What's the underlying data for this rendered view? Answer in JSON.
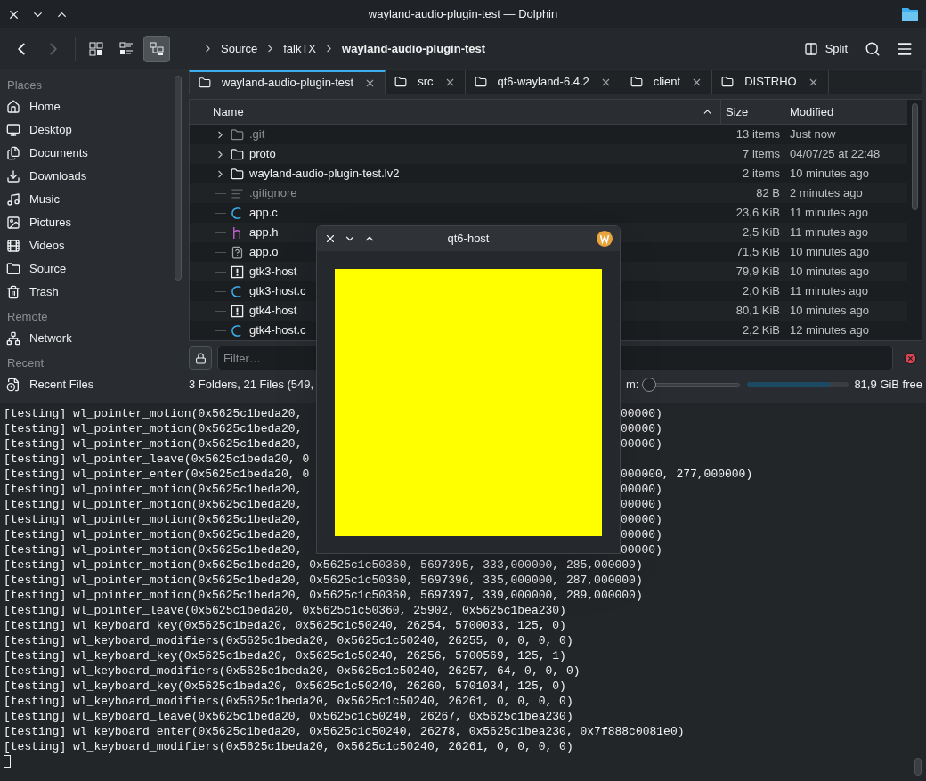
{
  "window": {
    "title": "wayland-audio-plugin-test — Dolphin"
  },
  "toolbar": {
    "back": {
      "disabled": false
    },
    "forward": {
      "disabled": true
    },
    "view_modes": [
      {
        "kind": "icons",
        "selected": false
      },
      {
        "kind": "compact",
        "selected": false
      },
      {
        "kind": "details",
        "selected": true
      }
    ],
    "breadcrumb": [
      {
        "label": "Source",
        "current": false
      },
      {
        "label": "falkTX",
        "current": false
      },
      {
        "label": "wayland-audio-plugin-test",
        "current": true
      }
    ],
    "split": "Split"
  },
  "sidebar": {
    "sections": [
      {
        "title": "Places",
        "items": [
          {
            "label": "Home",
            "kind": "home"
          },
          {
            "label": "Desktop",
            "kind": "desktop"
          },
          {
            "label": "Documents",
            "kind": "documents"
          },
          {
            "label": "Downloads",
            "kind": "downloads"
          },
          {
            "label": "Music",
            "kind": "music"
          },
          {
            "label": "Pictures",
            "kind": "pictures"
          },
          {
            "label": "Videos",
            "kind": "videos"
          },
          {
            "label": "Source",
            "kind": "folder"
          },
          {
            "label": "Trash",
            "kind": "trash"
          }
        ]
      },
      {
        "title": "Remote",
        "items": [
          {
            "label": "Network",
            "kind": "network"
          }
        ]
      },
      {
        "title": "Recent",
        "items": [
          {
            "label": "Recent Files",
            "kind": "recent"
          }
        ]
      }
    ]
  },
  "tabs": [
    {
      "label": "wayland-audio-plugin-test",
      "selected": true
    },
    {
      "label": "src",
      "selected": false
    },
    {
      "label": "qt6-wayland-6.4.2",
      "selected": false
    },
    {
      "label": "client",
      "selected": false
    },
    {
      "label": "DISTRHO",
      "selected": false
    }
  ],
  "table": {
    "columns": [
      "Name",
      "Size",
      "Modified"
    ],
    "rows": [
      {
        "name": ".git",
        "kind": "folder",
        "hidden": true,
        "expandable": true,
        "size": "13 items",
        "modified": "Just now"
      },
      {
        "name": "proto",
        "kind": "folder",
        "hidden": false,
        "expandable": true,
        "size": "7 items",
        "modified": "04/07/25 at 22:48"
      },
      {
        "name": "wayland-audio-plugin-test.lv2",
        "kind": "folder",
        "hidden": false,
        "expandable": true,
        "size": "2 items",
        "modified": "10 minutes ago"
      },
      {
        "name": ".gitignore",
        "kind": "text",
        "hidden": true,
        "expandable": false,
        "size": "82 B",
        "modified": "2 minutes ago"
      },
      {
        "name": "app.c",
        "kind": "c-source",
        "hidden": false,
        "expandable": false,
        "size": "23,6 KiB",
        "modified": "11 minutes ago"
      },
      {
        "name": "app.h",
        "kind": "header",
        "hidden": false,
        "expandable": false,
        "size": "2,5 KiB",
        "modified": "11 minutes ago"
      },
      {
        "name": "app.o",
        "kind": "binary",
        "hidden": false,
        "expandable": false,
        "size": "71,5 KiB",
        "modified": "10 minutes ago"
      },
      {
        "name": "gtk3-host",
        "kind": "executable",
        "hidden": false,
        "expandable": false,
        "size": "79,9 KiB",
        "modified": "10 minutes ago"
      },
      {
        "name": "gtk3-host.c",
        "kind": "c-source",
        "hidden": false,
        "expandable": false,
        "size": "2,0 KiB",
        "modified": "11 minutes ago"
      },
      {
        "name": "gtk4-host",
        "kind": "executable",
        "hidden": false,
        "expandable": false,
        "size": "80,1 KiB",
        "modified": "10 minutes ago"
      },
      {
        "name": "gtk4-host.c",
        "kind": "c-source",
        "hidden": false,
        "expandable": false,
        "size": "2,2 KiB",
        "modified": "12 minutes ago"
      }
    ]
  },
  "filter": {
    "placeholder": "Filter…"
  },
  "status_bar": {
    "summary": "3 Folders, 21 Files (549,",
    "zoom_label": "m:",
    "zoom": {
      "level": 0
    },
    "disk": {
      "level": 0.81
    },
    "free": "81,9 GiB free"
  },
  "popup": {
    "title": "qt6-host"
  },
  "terminal": {
    "lines": [
      {
        "left": "[testing] wl_pointer_motion(0x5625c1beda20,",
        "right": "00000)"
      },
      {
        "left": "[testing] wl_pointer_motion(0x5625c1beda20,",
        "right": "00000)"
      },
      {
        "left": "[testing] wl_pointer_motion(0x5625c1beda20,",
        "right": "00000)"
      },
      {
        "left": "[testing] wl_pointer_leave(0x5625c1beda20, 0"
      },
      {
        "left": "[testing] wl_pointer_enter(0x5625c1beda20, 0",
        "right": "000000, 277,000000)"
      },
      {
        "left": "[testing] wl_pointer_motion(0x5625c1beda20,",
        "right": "00000)"
      },
      {
        "left": "[testing] wl_pointer_motion(0x5625c1beda20,",
        "right": "00000)"
      },
      {
        "left": "[testing] wl_pointer_motion(0x5625c1beda20,",
        "right": "00000)"
      },
      {
        "left": "[testing] wl_pointer_motion(0x5625c1beda20,",
        "right": "00000)"
      },
      {
        "left": "[testing] wl_pointer_motion(0x5625c1beda20,",
        "right": "00000)"
      },
      {
        "text": "[testing] wl_pointer_motion(0x5625c1beda20, 0x5625c1c50360, 5697395, 333,000000, 285,000000)"
      },
      {
        "text": "[testing] wl_pointer_motion(0x5625c1beda20, 0x5625c1c50360, 5697396, 335,000000, 287,000000)"
      },
      {
        "text": "[testing] wl_pointer_motion(0x5625c1beda20, 0x5625c1c50360, 5697397, 339,000000, 289,000000)"
      },
      {
        "text": "[testing] wl_pointer_leave(0x5625c1beda20, 0x5625c1c50360, 25902, 0x5625c1bea230)"
      },
      {
        "text": "[testing] wl_keyboard_key(0x5625c1beda20, 0x5625c1c50240, 26254, 5700033, 125, 0)"
      },
      {
        "text": "[testing] wl_keyboard_modifiers(0x5625c1beda20, 0x5625c1c50240, 26255, 0, 0, 0, 0)"
      },
      {
        "text": "[testing] wl_keyboard_key(0x5625c1beda20, 0x5625c1c50240, 26256, 5700569, 125, 1)"
      },
      {
        "text": "[testing] wl_keyboard_modifiers(0x5625c1beda20, 0x5625c1c50240, 26257, 64, 0, 0, 0)"
      },
      {
        "text": "[testing] wl_keyboard_key(0x5625c1beda20, 0x5625c1c50240, 26260, 5701034, 125, 0)"
      },
      {
        "text": "[testing] wl_keyboard_modifiers(0x5625c1beda20, 0x5625c1c50240, 26261, 0, 0, 0, 0)"
      },
      {
        "text": "[testing] wl_keyboard_leave(0x5625c1beda20, 0x5625c1c50240, 26267, 0x5625c1bea230)"
      },
      {
        "text": "[testing] wl_keyboard_enter(0x5625c1beda20, 0x5625c1c50240, 26278, 0x5625c1bea230, 0x7f888c0081e0)"
      },
      {
        "text": "[testing] wl_keyboard_modifiers(0x5625c1beda20, 0x5625c1c50240, 26261, 0, 0, 0, 0)"
      }
    ]
  }
}
